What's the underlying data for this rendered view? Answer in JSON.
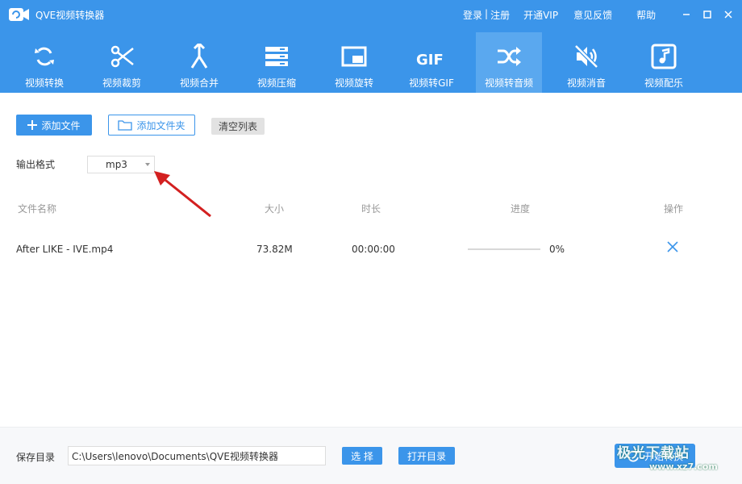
{
  "app": {
    "title": "QVE视频转换器"
  },
  "top_links": {
    "login": "登录",
    "separator": "|",
    "register": "注册",
    "vip": "开通VIP",
    "feedback": "意见反馈",
    "help": "帮助"
  },
  "window_controls": [
    "minimize-icon",
    "maximize-icon",
    "close-icon"
  ],
  "toolbar": {
    "active_index": 6,
    "items": [
      {
        "label": "视频转换",
        "icon": "convert-icon"
      },
      {
        "label": "视频裁剪",
        "icon": "scissors-icon"
      },
      {
        "label": "视频合并",
        "icon": "merge-icon"
      },
      {
        "label": "视频压缩",
        "icon": "compress-icon"
      },
      {
        "label": "视频旋转",
        "icon": "rotate-icon"
      },
      {
        "label": "视频转GIF",
        "icon": "gif-icon"
      },
      {
        "label": "视频转音频",
        "icon": "shuffle-icon"
      },
      {
        "label": "视频消音",
        "icon": "mute-icon"
      },
      {
        "label": "视频配乐",
        "icon": "music-note-icon"
      }
    ]
  },
  "actions": {
    "add_file": "添加文件",
    "add_folder": "添加文件夹",
    "clear_list": "清空列表"
  },
  "output_format": {
    "label": "输出格式",
    "value": "mp3"
  },
  "table": {
    "headers": {
      "name": "文件名称",
      "size": "大小",
      "duration": "时长",
      "progress": "进度",
      "action": "操作"
    },
    "rows": [
      {
        "name": "After LIKE - IVE.mp4",
        "size": "73.82M",
        "duration": "00:00:00",
        "progress_text": "0%",
        "progress": 0
      }
    ]
  },
  "bottom": {
    "save_label": "保存目录",
    "save_path": "C:\\Users\\lenovo\\Documents\\QVE视频转换器",
    "choose_button": "选 择",
    "open_dir_button": "打开目录",
    "start_button": "开始转换"
  },
  "watermark": {
    "text": "极光下载站",
    "url_text": "www.xz7.com"
  },
  "colors": {
    "primary": "#3b95ea",
    "active_tab": "#5aa8ef",
    "arrow": "#d32020"
  }
}
